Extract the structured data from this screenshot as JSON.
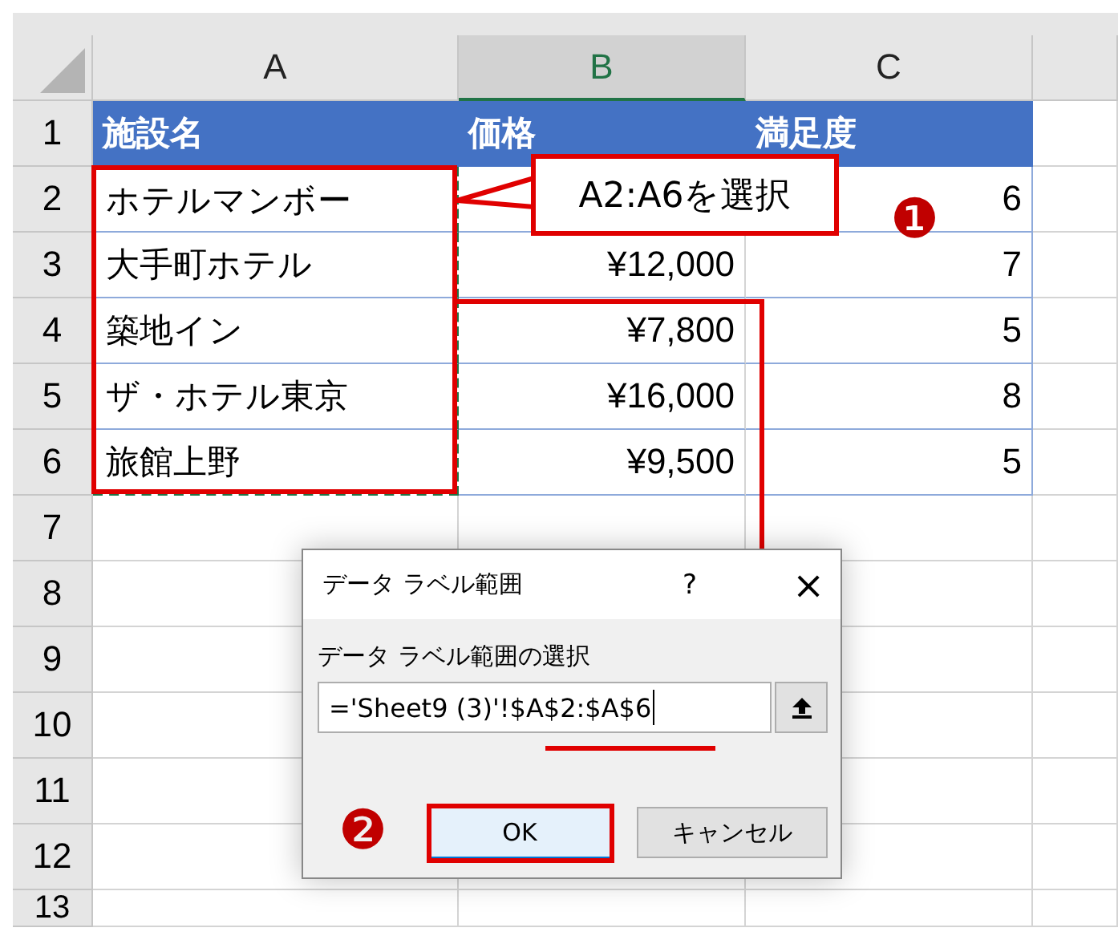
{
  "sheet": {
    "columns": [
      {
        "label": "A",
        "selected": false
      },
      {
        "label": "B",
        "selected": true
      },
      {
        "label": "C",
        "selected": false
      }
    ],
    "row_numbers": [
      "1",
      "2",
      "3",
      "4",
      "5",
      "6",
      "7",
      "8",
      "9",
      "10",
      "11",
      "12",
      "13"
    ],
    "header": [
      "施設名",
      "価格",
      "満足度"
    ],
    "rows": [
      {
        "name": "ホテルマンボー",
        "satisfaction": "6",
        "marquee": true
      },
      {
        "name": "大手町ホテル",
        "price": "¥12,000",
        "satisfaction": "7",
        "marquee": true
      },
      {
        "name": "築地イン",
        "price": "¥7,800",
        "satisfaction": "5",
        "marquee": true
      },
      {
        "name": "ザ・ホテル東京",
        "price": "¥16,000",
        "satisfaction": "8",
        "marquee": true
      },
      {
        "name": "旅館上野",
        "price": "¥9,500",
        "satisfaction": "5",
        "marquee": true
      }
    ]
  },
  "callout": {
    "text": "A2:A6を選択",
    "badge": "❶"
  },
  "dialog": {
    "title": "データ ラベル範囲",
    "help": "?",
    "close": "×",
    "label": "データ ラベル範囲の選択",
    "value": "='Sheet9 (3)'!$A$2:$A$6",
    "buttons": [
      {
        "label": "OK",
        "default": true
      },
      {
        "label": "キャンセル",
        "default": false
      }
    ],
    "badge": "❷"
  }
}
